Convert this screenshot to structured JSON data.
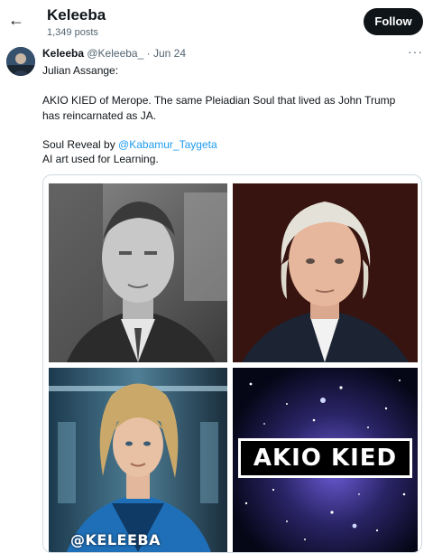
{
  "header": {
    "back_icon": "arrow-left-icon",
    "profile_name": "Keleeba",
    "post_count": "1,349 posts",
    "follow_label": "Follow"
  },
  "tweet": {
    "author_name": "Keleeba",
    "author_handle": "@Keleeba_",
    "separator": "·",
    "date": "Jun 24",
    "more_icon": "more-options-icon",
    "lines": {
      "l1": "Julian Assange:",
      "l2": "AKIO KIED of Merope. The same Pleiadian Soul that lived as John Trump",
      "l3": "has reincarnated as JA.",
      "l4_prefix": "Soul Reveal by ",
      "l4_mention": "@Kabamur_Taygeta",
      "l5": "AI art used for Learning."
    },
    "media": {
      "watermark": "@KELEEBA",
      "banner": "AKIO KIED"
    }
  },
  "colors": {
    "text": "#0f1419",
    "secondary": "#536471",
    "link": "#1d9bf0",
    "follow_bg": "#0f1419"
  }
}
